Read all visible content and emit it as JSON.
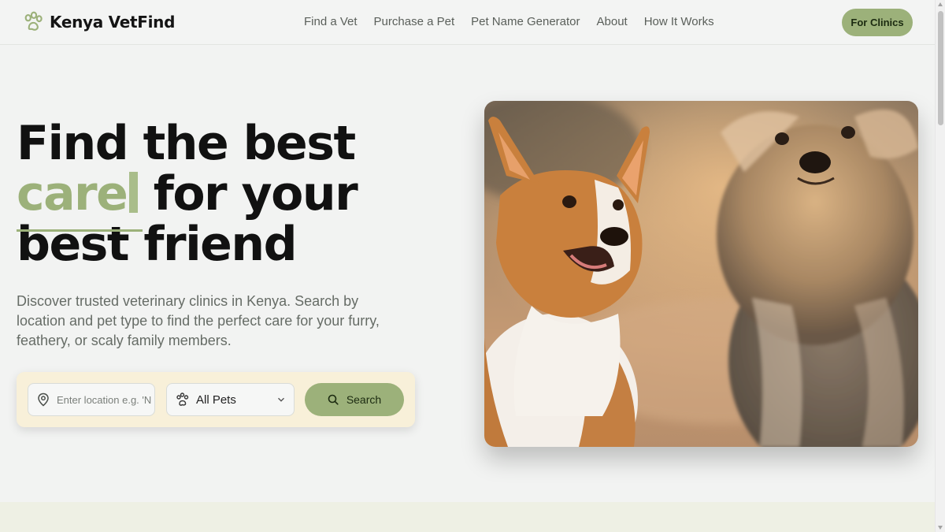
{
  "nav": {
    "brand": "Kenya VetFind",
    "brand_icon": "paw-icon",
    "links": [
      "Find a Vet",
      "Purchase a Pet",
      "Pet Name Generator",
      "About",
      "How It Works"
    ],
    "cta": "For Clinics"
  },
  "hero": {
    "title_line1": "Find the best",
    "title_accent": "care",
    "title_line2_rest": " for your",
    "title_line3": "best friend",
    "description": "Discover trusted veterinary clinics in Kenya. Search by location and pet type to find the perfect care for your furry, feathery, or scaly family members."
  },
  "search": {
    "location_placeholder": "Enter location e.g. 'Nairobi'",
    "location_value": "",
    "pet_type": "All Pets",
    "button": "Search",
    "icons": [
      "map-pin-icon",
      "paw-icon",
      "chevron-down-icon",
      "search-icon"
    ]
  },
  "image": {
    "subject": "corgi and yorkshire terrier photo"
  },
  "colors": {
    "accent": "#9cb17a",
    "background": "#f2f3f2",
    "search_card": "#f8f0d9",
    "bottom_band": "#eef0e4"
  }
}
